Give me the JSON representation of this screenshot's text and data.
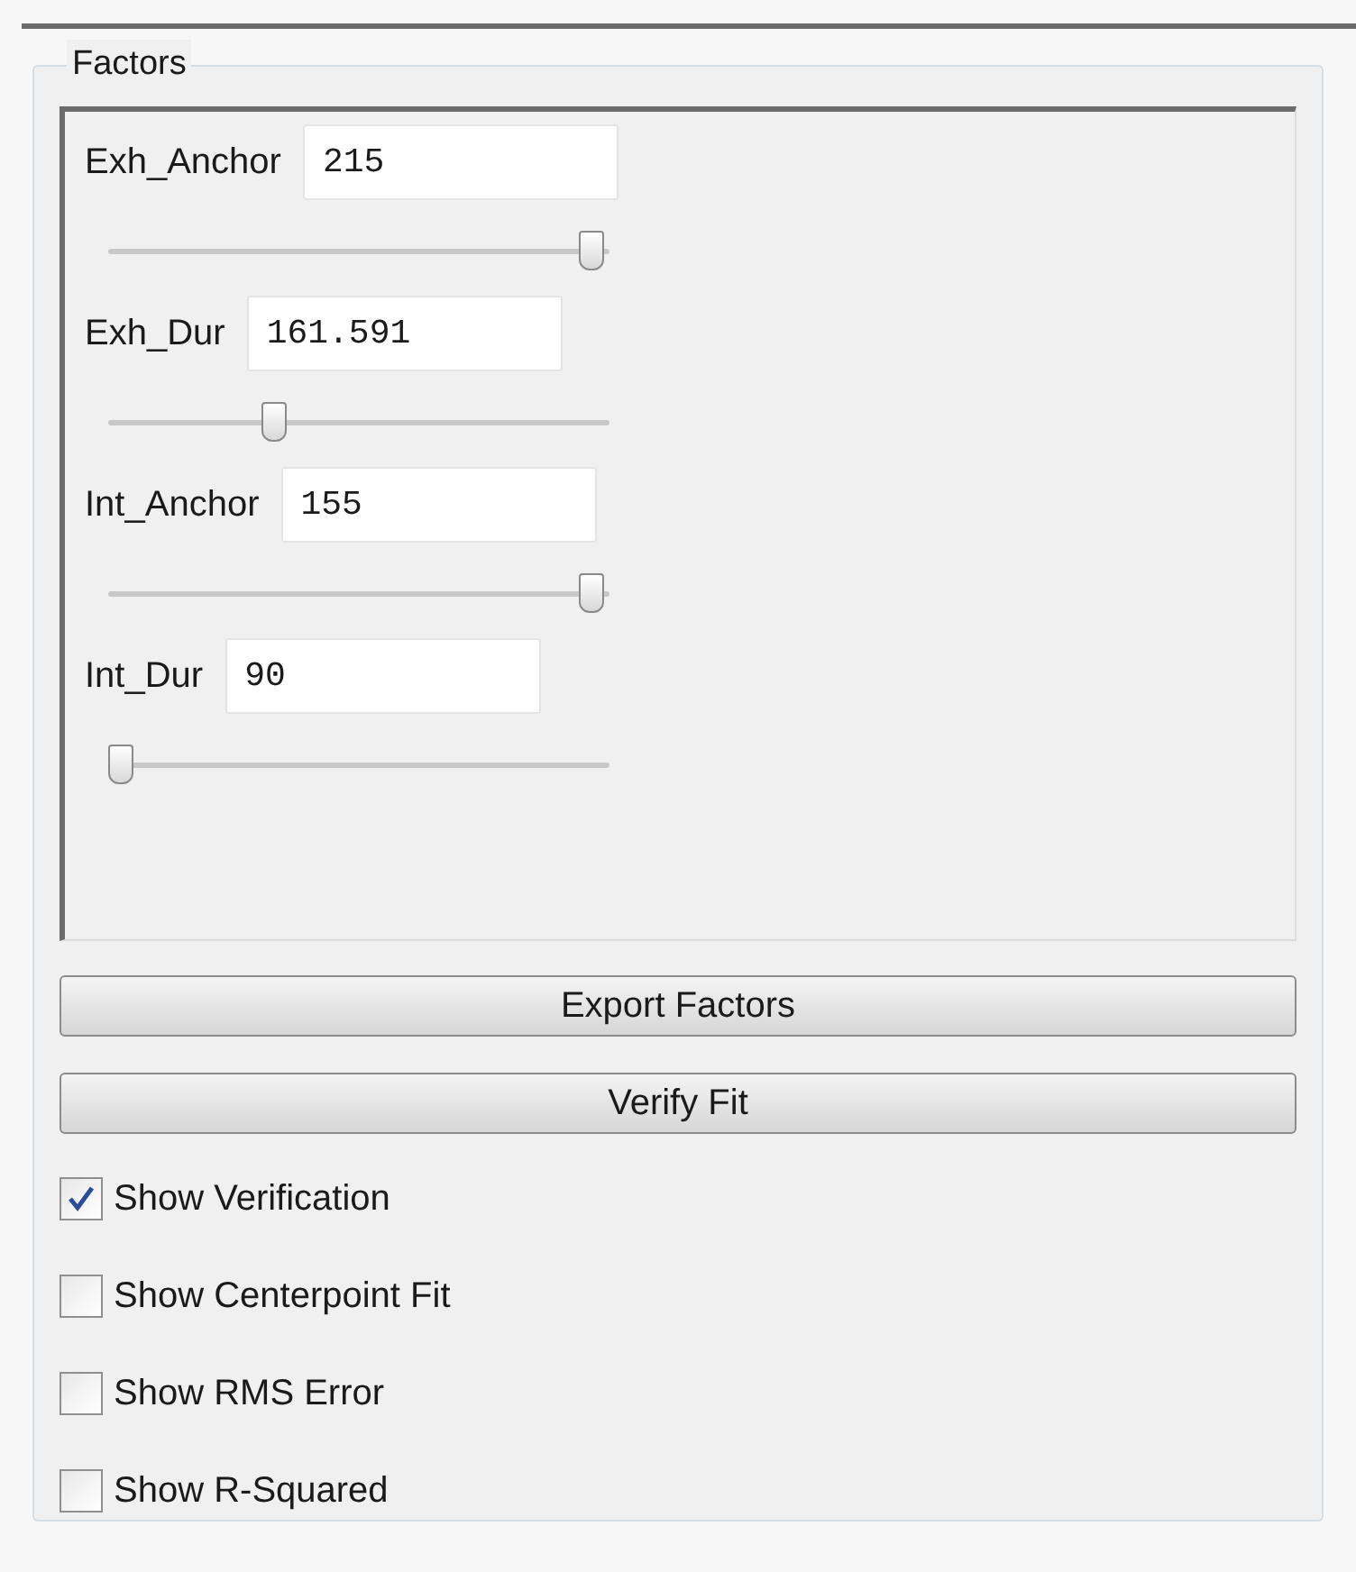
{
  "group": {
    "title": "Factors"
  },
  "factors": [
    {
      "label": "Exh_Anchor",
      "value": "215",
      "level": 0.97
    },
    {
      "label": "Exh_Dur",
      "value": "161.591",
      "level": 0.33
    },
    {
      "label": "Int_Anchor",
      "value": "155",
      "level": 0.97
    },
    {
      "label": "Int_Dur",
      "value": "90",
      "level": 0.02
    }
  ],
  "buttons": [
    "Export Factors",
    "Verify Fit"
  ],
  "checkboxes": [
    {
      "label": "Show Verification",
      "checked": true
    },
    {
      "label": "Show Centerpoint Fit",
      "checked": false
    },
    {
      "label": "Show RMS Error",
      "checked": false
    },
    {
      "label": "Show R-Squared",
      "checked": false
    }
  ]
}
